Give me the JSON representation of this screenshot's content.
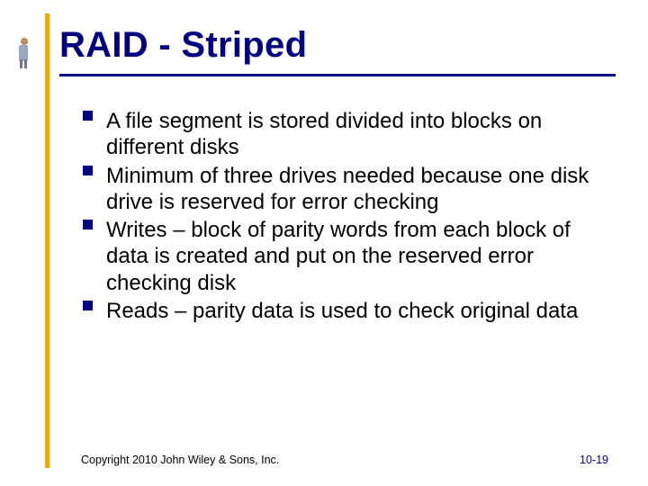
{
  "title": "RAID - Striped",
  "bullets": [
    "A file segment is stored divided into blocks on different disks",
    "Minimum of three drives needed because one disk drive is reserved for error checking",
    "Writes – block of parity words from each block of data is created and put on the reserved error checking disk",
    "Reads – parity data is used to check original data"
  ],
  "copyright": "Copyright 2010 John Wiley & Sons, Inc.",
  "pagenum": "10-19"
}
